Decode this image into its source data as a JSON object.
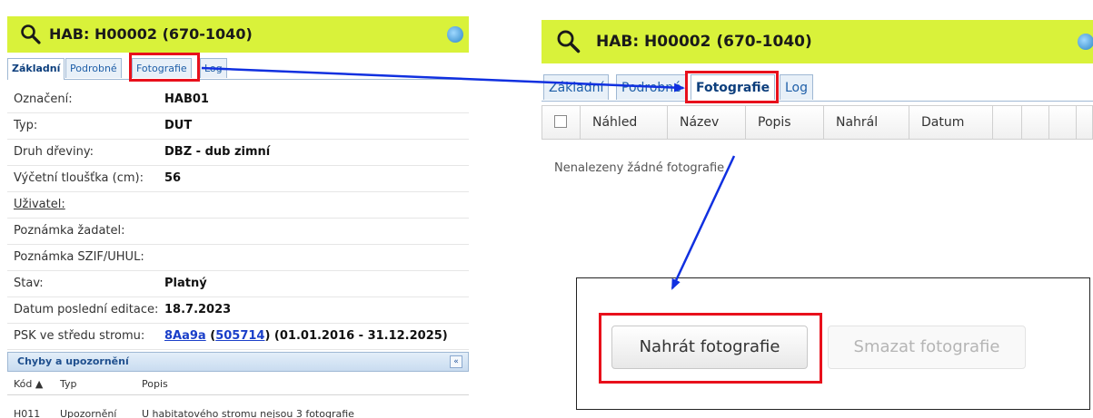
{
  "colors": {
    "header_bg": "#d9f23a",
    "highlight_red": "#e8101b",
    "arrow_blue": "#1030e0",
    "link_blue": "#1a3fc9"
  },
  "left_panel": {
    "title": "HAB: H00002 (670-1040)",
    "icons": {
      "search": "magnifier-icon",
      "refresh": "refresh-icon"
    },
    "tabs": [
      "Základní",
      "Podrobné",
      "Fotografie",
      "Log"
    ],
    "properties": [
      {
        "label": "Označení:",
        "value": "HAB01"
      },
      {
        "label": "Typ:",
        "value": "DUT"
      },
      {
        "label": "Druh dřeviny:",
        "value": "DBZ - dub zimní"
      },
      {
        "label": "Výčetní tloušťka (cm):",
        "value": "56"
      },
      {
        "label": "Uživatel:",
        "value": ""
      },
      {
        "label": "Poznámka žadatel:",
        "value": ""
      },
      {
        "label": "Poznámka SZIF/UHUL:",
        "value": ""
      },
      {
        "label": "Stav:",
        "value": "Platný"
      },
      {
        "label": "Datum poslední editace:",
        "value": "18.7.2023"
      }
    ],
    "psk": {
      "label": "PSK ve středu stromu:",
      "code": "8Aa9a",
      "open_paren": "(",
      "id": "505714",
      "rest": ") (01.01.2016 - 31.12.2025)"
    },
    "warnings_section": {
      "title": "Chyby a upozornění",
      "collapse": "«",
      "columns": [
        "Kód ▲",
        "Typ",
        "Popis"
      ],
      "rows": [
        {
          "code": "H011",
          "type": "Upozornění",
          "desc": "U habitatového stromu nejsou 3 fotografie"
        }
      ]
    }
  },
  "right_panel": {
    "title": "HAB: H00002 (670-1040)",
    "tabs": [
      "Základní",
      "Podrobné",
      "Fotografie",
      "Log"
    ],
    "columns": [
      "Náhled",
      "Název",
      "Popis",
      "Nahrál",
      "Datum"
    ],
    "empty_message": "Nenalezeny žádné fotografie",
    "buttons": {
      "upload": "Nahrát fotografie",
      "delete": "Smazat fotografie"
    }
  }
}
